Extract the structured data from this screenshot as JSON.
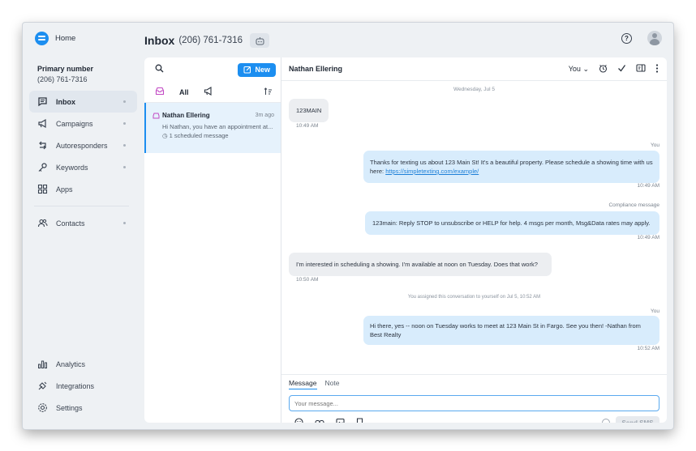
{
  "brand": {
    "label": "Home"
  },
  "primary": {
    "label": "Primary number",
    "number": "(206) 761-7316"
  },
  "nav": [
    {
      "label": "Inbox",
      "icon": "chat-icon",
      "active": true,
      "dot": true
    },
    {
      "label": "Campaigns",
      "icon": "megaphone-icon",
      "dot": true
    },
    {
      "label": "Autoresponders",
      "icon": "autoresponder-icon",
      "dot": true
    },
    {
      "label": "Keywords",
      "icon": "key-icon",
      "dot": true
    },
    {
      "label": "Apps",
      "icon": "apps-grid-icon",
      "dot": false
    },
    {
      "label": "Contacts",
      "icon": "contacts-icon",
      "dot": true
    }
  ],
  "nav_bottom": [
    {
      "label": "Analytics",
      "icon": "bar-chart-icon"
    },
    {
      "label": "Integrations",
      "icon": "integrations-icon"
    },
    {
      "label": "Settings",
      "icon": "gear-icon"
    }
  ],
  "header": {
    "title": "Inbox",
    "number": "(206) 761-7316"
  },
  "list": {
    "new_label": "New",
    "filter_all": "All",
    "conversation": {
      "name": "Nathan Ellering",
      "time": "3m ago",
      "preview": "Hi Nathan, you have an appointment at...",
      "scheduled": "1 scheduled message"
    }
  },
  "chat": {
    "contact": "Nathan Ellering",
    "assignee": "You",
    "day": "Wednesday, Jul 5",
    "messages": [
      {
        "dir": "in",
        "text": "123MAIN",
        "time": "10:49 AM"
      },
      {
        "dir": "out",
        "sender": "You",
        "text": "Thanks for texting us about 123 Main St! It's a beautiful property. Please schedule a showing time with us here: ",
        "link": "https://simpletexting.com/example/",
        "time": "10:49 AM"
      },
      {
        "dir": "out",
        "sender": "Compliance message",
        "text": "123main: Reply STOP to unsubscribe or HELP for help. 4 msgs per month, Msg&Data rates may apply.",
        "time": "10:49 AM"
      },
      {
        "dir": "in",
        "text": "I'm interested in scheduling a showing. I'm available at noon on Tuesday. Does that work?",
        "time": "10:50 AM"
      },
      {
        "dir": "out",
        "sender": "You",
        "text": "Hi there, yes -- noon on Tuesday works to meet at 123 Main St in Fargo. See you then! -Nathan from Best Realty",
        "time": "10:52 AM"
      }
    ],
    "system_note": "You assigned this conversation to yourself on Jul 5, 10:52 AM"
  },
  "composer": {
    "tab_message": "Message",
    "tab_note": "Note",
    "placeholder": "Your message...",
    "send_label": "Send SMS"
  },
  "colors": {
    "accent": "#1c8ef0",
    "bubble_out": "#d8ecfc",
    "bubble_in": "#eceef1"
  }
}
